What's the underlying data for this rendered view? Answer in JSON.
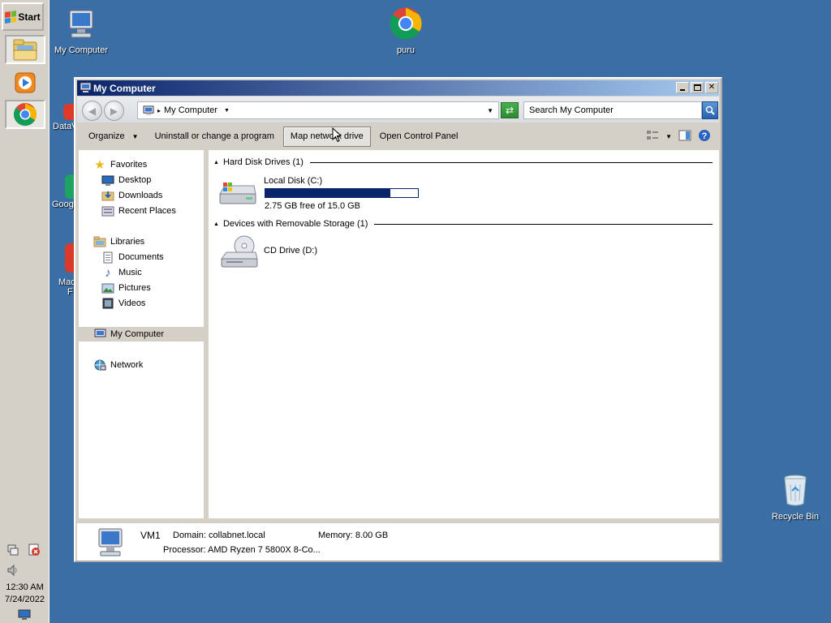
{
  "taskbar": {
    "start_label": "Start",
    "tasks": [
      {
        "name": "explorer-task",
        "icon": "folder-icon",
        "active": true
      },
      {
        "name": "media-player-task",
        "icon": "media-player-icon",
        "active": false
      },
      {
        "name": "chrome-task",
        "icon": "chrome-icon",
        "active": true
      }
    ],
    "clock_time": "12:30 AM",
    "clock_date": "7/24/2022"
  },
  "desktop": {
    "icons": [
      {
        "label": "My Computer",
        "icon": "computer-icon"
      },
      {
        "label": "puru",
        "icon": "chrome-icon"
      },
      {
        "label": "Recycle Bin",
        "icon": "recycle-bin-icon"
      }
    ],
    "partial_labels": [
      "DataV",
      "Googl",
      "Mac",
      "F"
    ]
  },
  "window": {
    "title": "My Computer",
    "address": {
      "path": "My Computer",
      "separator": "▸"
    },
    "search": {
      "placeholder": "Search My Computer"
    },
    "toolbar": {
      "organize": "Organize",
      "uninstall": "Uninstall or change a program",
      "map_drive": "Map network drive",
      "control_panel": "Open Control Panel"
    },
    "nav": {
      "favorites": "Favorites",
      "desktop": "Desktop",
      "downloads": "Downloads",
      "recent": "Recent Places",
      "libraries": "Libraries",
      "documents": "Documents",
      "music": "Music",
      "pictures": "Pictures",
      "videos": "Videos",
      "my_computer": "My Computer",
      "network": "Network"
    },
    "content": {
      "group_hdd": "Hard Disk Drives (1)",
      "group_removable": "Devices with Removable Storage (1)",
      "local_disk": {
        "name": "Local Disk (C:)",
        "free_text": "2.75 GB free of 15.0 GB",
        "used_fraction": 0.817
      },
      "cd_drive": {
        "name": "CD Drive (D:)"
      }
    },
    "details": {
      "computer_name": "VM1",
      "domain": "Domain: collabnet.local",
      "memory": "Memory: 8.00 GB",
      "processor": "Processor: AMD Ryzen 7 5800X 8-Co..."
    }
  },
  "colors": {
    "desktop": "#3a6ea5",
    "title_start": "#0a246a",
    "title_end": "#a6caf0",
    "progress": "#0a246a"
  }
}
